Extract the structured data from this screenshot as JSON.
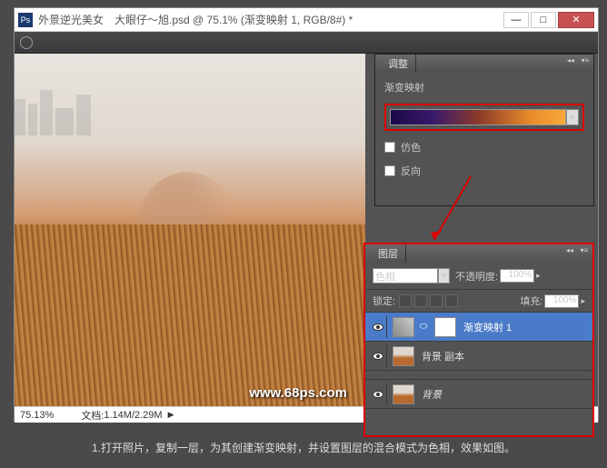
{
  "title": "外景逆光美女　大眼仔～旭.psd @ 75.1% (渐变映射 1, RGB/8#) *",
  "adjust_panel": {
    "tab": "调整",
    "label": "渐变映射",
    "dither": "仿色",
    "reverse": "反向"
  },
  "layers_panel": {
    "tab": "图层",
    "blend_mode": "色相",
    "opacity_label": "不透明度:",
    "opacity_value": "100%",
    "lock_label": "锁定:",
    "fill_label": "填充:",
    "fill_value": "100%",
    "layers": [
      {
        "name": "渐变映射 1",
        "selected": true,
        "type": "adjustment"
      },
      {
        "name": "背景 副本",
        "selected": false,
        "type": "image"
      },
      {
        "name": "背景",
        "selected": false,
        "type": "image",
        "italic": true
      }
    ]
  },
  "status": {
    "zoom": "75.13%",
    "doc_label": "文档:",
    "doc_size": "1.14M/2.29M"
  },
  "watermark": "www.68ps.com",
  "caption": "1.打开照片，复制一层，为其创建渐变映射，并设置图层的混合模式为色相，效果如图。"
}
